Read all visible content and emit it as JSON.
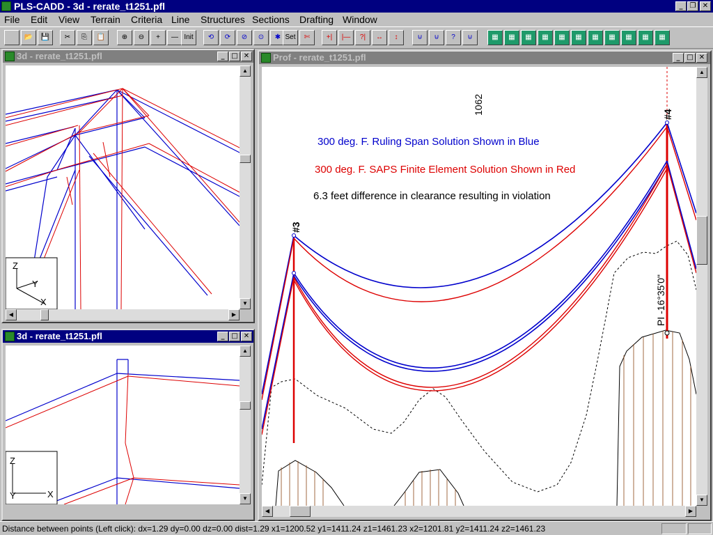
{
  "app": {
    "title": "PLS-CADD - 3d - rerate_t1251.pfl",
    "min_label": "_",
    "restore_label": "❐",
    "close_label": "✕"
  },
  "menu": [
    "File",
    "Edit",
    "View",
    "Terrain",
    "Criteria",
    "Line",
    "Structures",
    "Sections",
    "Drafting",
    "Window"
  ],
  "toolbar": {
    "buttons": [
      "",
      "📂",
      "💾",
      "✂",
      "⎘",
      "📋",
      "⊕",
      "⊖",
      "+",
      "—",
      "Init",
      "⟲",
      "⟳",
      "⊘",
      "⊙",
      "✱",
      "Set",
      "✄",
      "+|",
      "|—",
      "?|",
      "↔",
      "↕",
      "⊍",
      "⊍",
      "?",
      "⊍",
      "▦",
      "▦",
      "▦",
      "▦",
      "▦",
      "▦",
      "▦",
      "▦",
      "▦",
      "▦",
      "▦"
    ]
  },
  "windows": {
    "top_left_title": "3d - rerate_t1251.pfl",
    "bottom_left_title": "3d - rerate_t1251.pfl",
    "profile_title": "Prof - rerate_t1251.pfl"
  },
  "axis_labels": {
    "z": "Z",
    "y": "Y",
    "x": "X"
  },
  "profile": {
    "station_label": "1062",
    "structure_3": "#3",
    "structure_4": "#4",
    "pi_label": "PI -16°35'0\"",
    "blue_note": "300 deg. F. Ruling Span Solution Shown in Blue",
    "red_note": "300 deg. F. SAPS Finite Element Solution Shown in Red",
    "black_note": "6.3 feet difference in clearance resulting in violation",
    "blue_color": "#0000cc",
    "red_color": "#dd0000"
  },
  "status": {
    "text": "Distance between points (Left click):  dx=1.29 dy=0.00 dz=0.00 dist=1.29 x1=1200.52 y1=1411.24 z1=1461.23 x2=1201.81 y2=1411.24 z2=1461.23"
  }
}
